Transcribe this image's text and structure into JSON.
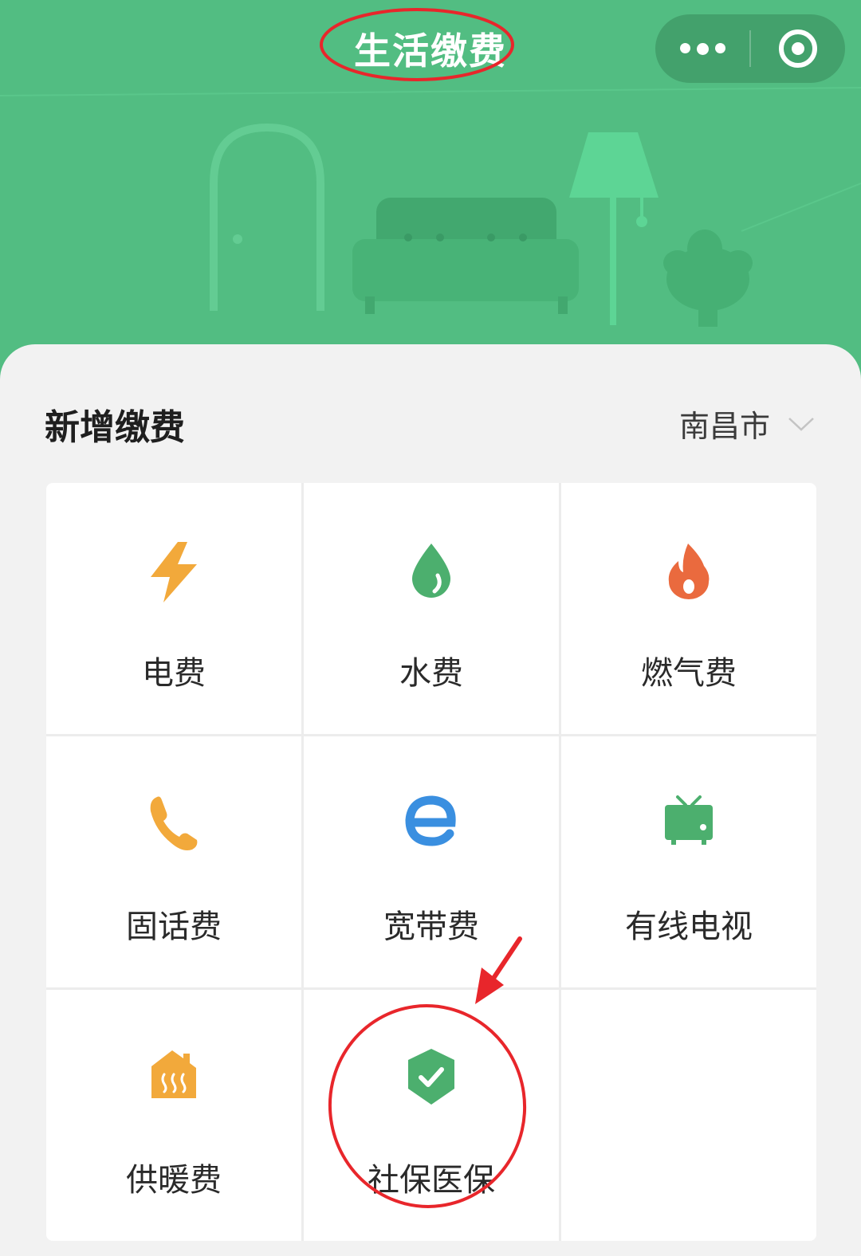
{
  "header": {
    "title": "生活缴费",
    "menu_icon": "more-dots-icon",
    "close_icon": "target-circle-icon",
    "background_color": "#52bd82"
  },
  "section": {
    "title": "新增缴费",
    "city": "南昌市",
    "city_icon": "chevron-down-icon"
  },
  "services": [
    {
      "label": "电费",
      "icon": "lightning-icon",
      "color": "#f2a93b"
    },
    {
      "label": "水费",
      "icon": "water-drop-icon",
      "color": "#4caf6e"
    },
    {
      "label": "燃气费",
      "icon": "flame-icon",
      "color": "#ea6a3e"
    },
    {
      "label": "固话费",
      "icon": "phone-icon",
      "color": "#f2a93b"
    },
    {
      "label": "宽带费",
      "icon": "broadband-e-icon",
      "color": "#3a8fe0"
    },
    {
      "label": "有线电视",
      "icon": "tv-icon",
      "color": "#4caf6e"
    },
    {
      "label": "供暖费",
      "icon": "heating-house-icon",
      "color": "#f2a93b"
    },
    {
      "label": "社保医保",
      "icon": "shield-check-icon",
      "color": "#4caf6e"
    }
  ],
  "annotation_color": "#e8262b"
}
